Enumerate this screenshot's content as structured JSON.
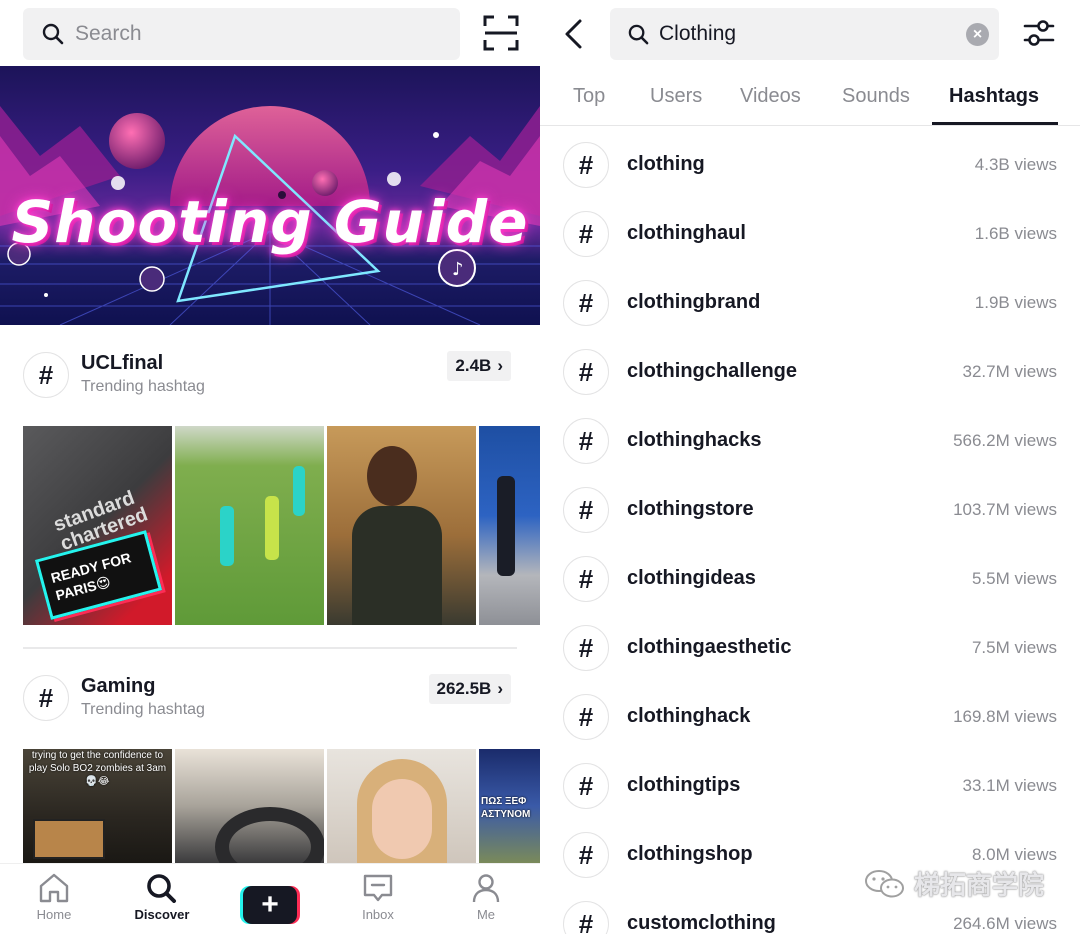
{
  "left": {
    "search_placeholder": "Search",
    "banner_title": "Shooting Guide",
    "sections": [
      {
        "name": "UCLfinal",
        "subtitle": "Trending hashtag",
        "count": "2.4B",
        "thumb_texts": [
          "READY FOR PARIS😍",
          "",
          "",
          ""
        ]
      },
      {
        "name": "Gaming",
        "subtitle": "Trending hashtag",
        "count": "262.5B",
        "thumb_texts": [
          "trying to get the confidence to play Solo BO2 zombies at 3am💀😂",
          "",
          "",
          "ΠΩΣ ΞΕΦ ΑΣΤΥΝΟΜ"
        ]
      }
    ],
    "tabbar": {
      "home": "Home",
      "discover": "Discover",
      "create": "+",
      "inbox": "Inbox",
      "me": "Me"
    }
  },
  "right": {
    "search_value": "Clothing",
    "tabs": [
      "Top",
      "Users",
      "Videos",
      "Sounds",
      "Hashtags"
    ],
    "active_tab": "Hashtags",
    "results": [
      {
        "name": "clothing",
        "views": "4.3B views"
      },
      {
        "name": "clothinghaul",
        "views": "1.6B views"
      },
      {
        "name": "clothingbrand",
        "views": "1.9B views"
      },
      {
        "name": "clothingchallenge",
        "views": "32.7M views"
      },
      {
        "name": "clothinghacks",
        "views": "566.2M views"
      },
      {
        "name": "clothingstore",
        "views": "103.7M views"
      },
      {
        "name": "clothingideas",
        "views": "5.5M views"
      },
      {
        "name": "clothingaesthetic",
        "views": "7.5M views"
      },
      {
        "name": "clothinghack",
        "views": "169.8M views"
      },
      {
        "name": "clothingtips",
        "views": "33.1M views"
      },
      {
        "name": "clothingshop",
        "views": "8.0M views"
      },
      {
        "name": "customclothing",
        "views": "264.6M views"
      }
    ]
  },
  "watermark": "梯拓商学院",
  "colors": {
    "text": "#161823",
    "secondary": "#8a8b91",
    "accent_red": "#fe2c55",
    "accent_cyan": "#25f4ee"
  }
}
